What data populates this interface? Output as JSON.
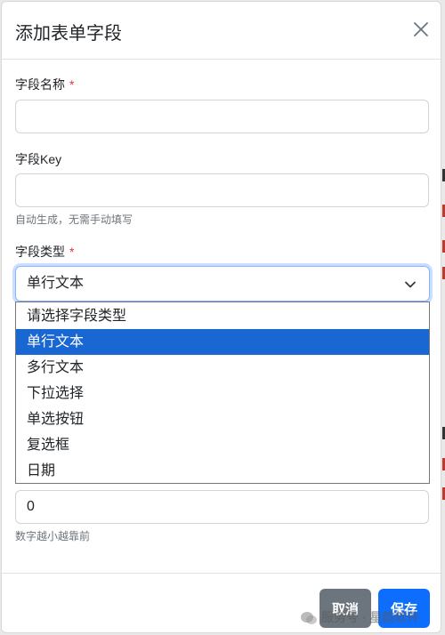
{
  "modal": {
    "title": "添加表单字段",
    "close_icon": "close-icon"
  },
  "fields": {
    "name": {
      "label": "字段名称",
      "required_mark": "*",
      "value": ""
    },
    "key": {
      "label": "字段Key",
      "value": "",
      "help": "自动生成，无需手动填写"
    },
    "type": {
      "label": "字段类型",
      "required_mark": "*",
      "selected": "单行文本",
      "options": [
        "请选择字段类型",
        "单行文本",
        "多行文本",
        "下拉选择",
        "单选按钮",
        "复选框",
        "日期"
      ],
      "highlighted_index": 1
    },
    "order": {
      "value": "0",
      "help": "数字越小越靠前"
    }
  },
  "footer": {
    "cancel_label": "取消",
    "save_label": "保存"
  },
  "watermark": "服务号 · 星韵软件",
  "colors": {
    "primary": "#0d6efd",
    "secondary": "#6c757d",
    "required": "#dc3545",
    "option_highlight": "#1967d2"
  }
}
